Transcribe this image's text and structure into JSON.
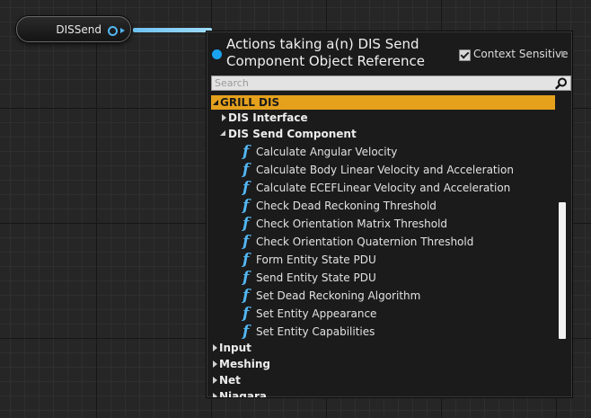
{
  "node": {
    "label": "DISSend",
    "pin_color": "#52b6f2"
  },
  "menu": {
    "title_line1": "Actions taking a(n) DIS Send",
    "title_line2": "Component Object Reference",
    "context_sensitive_label": "Context Sensitive",
    "context_sensitive_checked": true,
    "search_placeholder": "Search",
    "category": "GRILL DIS",
    "category_color": "#e5a11c",
    "subcategories": [
      {
        "label": "DIS Interface",
        "expanded": false
      },
      {
        "label": "DIS Send Component",
        "expanded": true
      }
    ],
    "functions": [
      "Calculate Angular Velocity",
      "Calculate Body Linear Velocity and Acceleration",
      "Calculate ECEFLinear Velocity and Acceleration",
      "Check Dead Reckoning Threshold",
      "Check Orientation Matrix Threshold",
      "Check Orientation Quaternion Threshold",
      "Form Entity State PDU",
      "Send Entity State PDU",
      "Set Dead Reckoning Algorithm",
      "Set Entity Appearance",
      "Set Entity Capabilities"
    ],
    "other_categories": [
      "Input",
      "Meshing",
      "Net",
      "Niagara"
    ],
    "function_icon": "f",
    "accent_color": "#1aa3ef"
  }
}
